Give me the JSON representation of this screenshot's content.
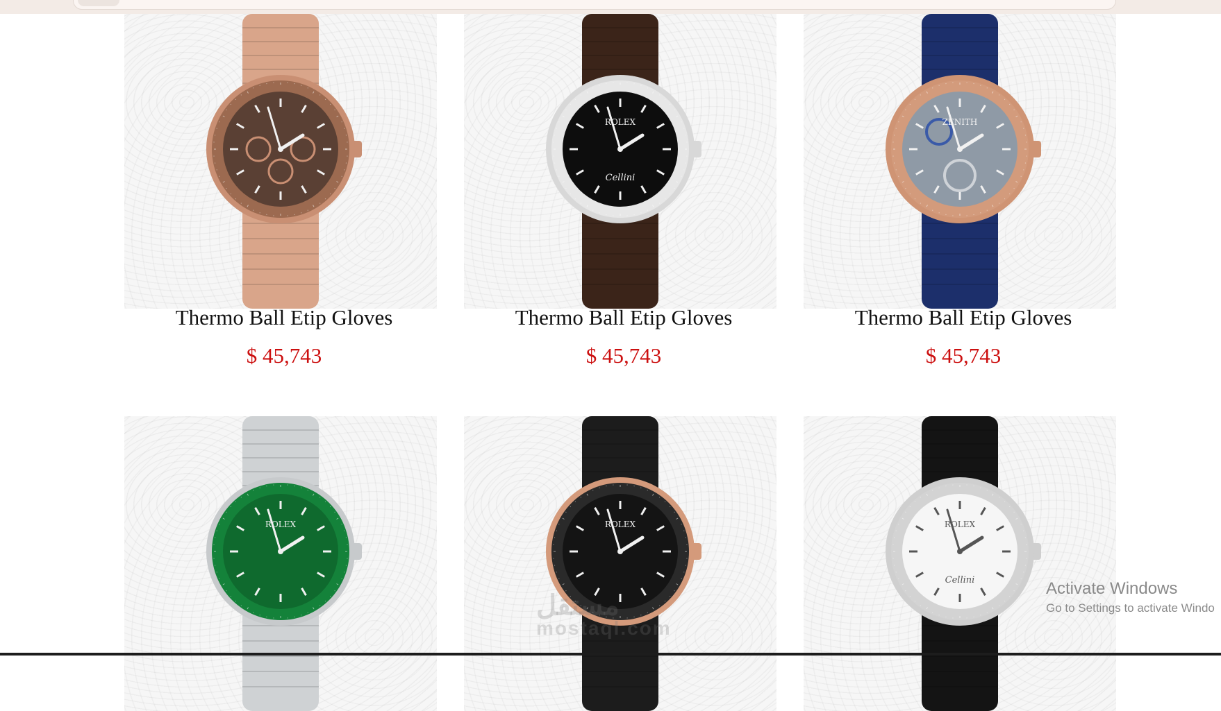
{
  "browser": {
    "url": ""
  },
  "products": [
    {
      "name": "Thermo Ball Etip Gloves",
      "price": "$ 45,743",
      "image": "rose-gold-chronograph-watch",
      "dial": "#5a4034",
      "bezel": "#9c6a50",
      "strap": "#d9a58a",
      "case": "#c98f73"
    },
    {
      "name": "Thermo Ball Etip Gloves",
      "price": "$ 45,743",
      "image": "diamond-bezel-black-dial-watch",
      "dial": "#0d0d0d",
      "bezel": "#e7e7e7",
      "strap": "#3b2419",
      "case": "#d8d8d8",
      "dial_brand": "ROLEX",
      "dial_script": "Cellini"
    },
    {
      "name": "Thermo Ball Etip Gloves",
      "price": "$ 45,743",
      "image": "skeleton-tourbillon-watch",
      "dial": "#8f9aa6",
      "bezel": "#d39b7c",
      "strap": "#1c2f6b",
      "case": "#cf9474",
      "dial_brand": "ZENITH"
    },
    {
      "name": "",
      "price": "",
      "image": "green-submariner-watch",
      "dial": "#0f6a2e",
      "bezel": "#14823a",
      "strap": "#cfd2d4",
      "case": "#c7cacc",
      "dial_brand": "ROLEX"
    },
    {
      "name": "",
      "price": "",
      "image": "black-rose-gold-yachtmaster-watch",
      "dial": "#141414",
      "bezel": "#2a2a2a",
      "strap": "#1c1c1c",
      "case": "#d49a7b",
      "dial_brand": "ROLEX"
    },
    {
      "name": "",
      "price": "",
      "image": "white-dial-cellini-watch",
      "dial": "#f6f6f6",
      "bezel": "#d3d3d3",
      "strap": "#141414",
      "case": "#cfcfcf",
      "dial_brand": "ROLEX",
      "dial_script": "Cellini"
    }
  ],
  "watermark": {
    "line1": "مستقل",
    "line2": "mostaql.com"
  },
  "windows_notice": {
    "title": "Activate Windows",
    "subtitle": "Go to Settings to activate Windo"
  },
  "colors": {
    "price": "#cc1010",
    "name": "#111111"
  }
}
